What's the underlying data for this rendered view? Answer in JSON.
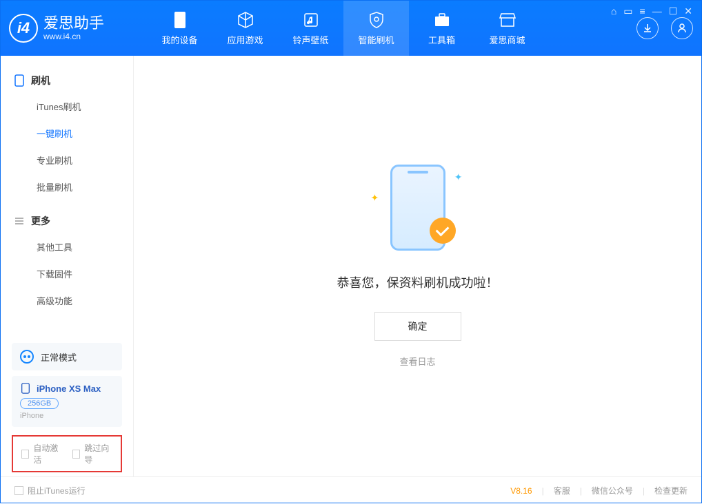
{
  "header": {
    "app_name": "爱思助手",
    "app_url": "www.i4.cn",
    "tabs": [
      {
        "label": "我的设备"
      },
      {
        "label": "应用游戏"
      },
      {
        "label": "铃声壁纸"
      },
      {
        "label": "智能刷机"
      },
      {
        "label": "工具箱"
      },
      {
        "label": "爱思商城"
      }
    ]
  },
  "sidebar": {
    "group1": {
      "title": "刷机",
      "items": [
        "iTunes刷机",
        "一键刷机",
        "专业刷机",
        "批量刷机"
      ]
    },
    "group2": {
      "title": "更多",
      "items": [
        "其他工具",
        "下载固件",
        "高级功能"
      ]
    },
    "mode_label": "正常模式",
    "device_name": "iPhone XS Max",
    "storage": "256GB",
    "device_type": "iPhone",
    "checkbox1": "自动激活",
    "checkbox2": "跳过向导"
  },
  "main": {
    "success_message": "恭喜您，保资料刷机成功啦！",
    "confirm_label": "确定",
    "view_log_label": "查看日志"
  },
  "footer": {
    "block_itunes": "阻止iTunes运行",
    "version": "V8.16",
    "support": "客服",
    "wechat": "微信公众号",
    "check_update": "检查更新"
  }
}
